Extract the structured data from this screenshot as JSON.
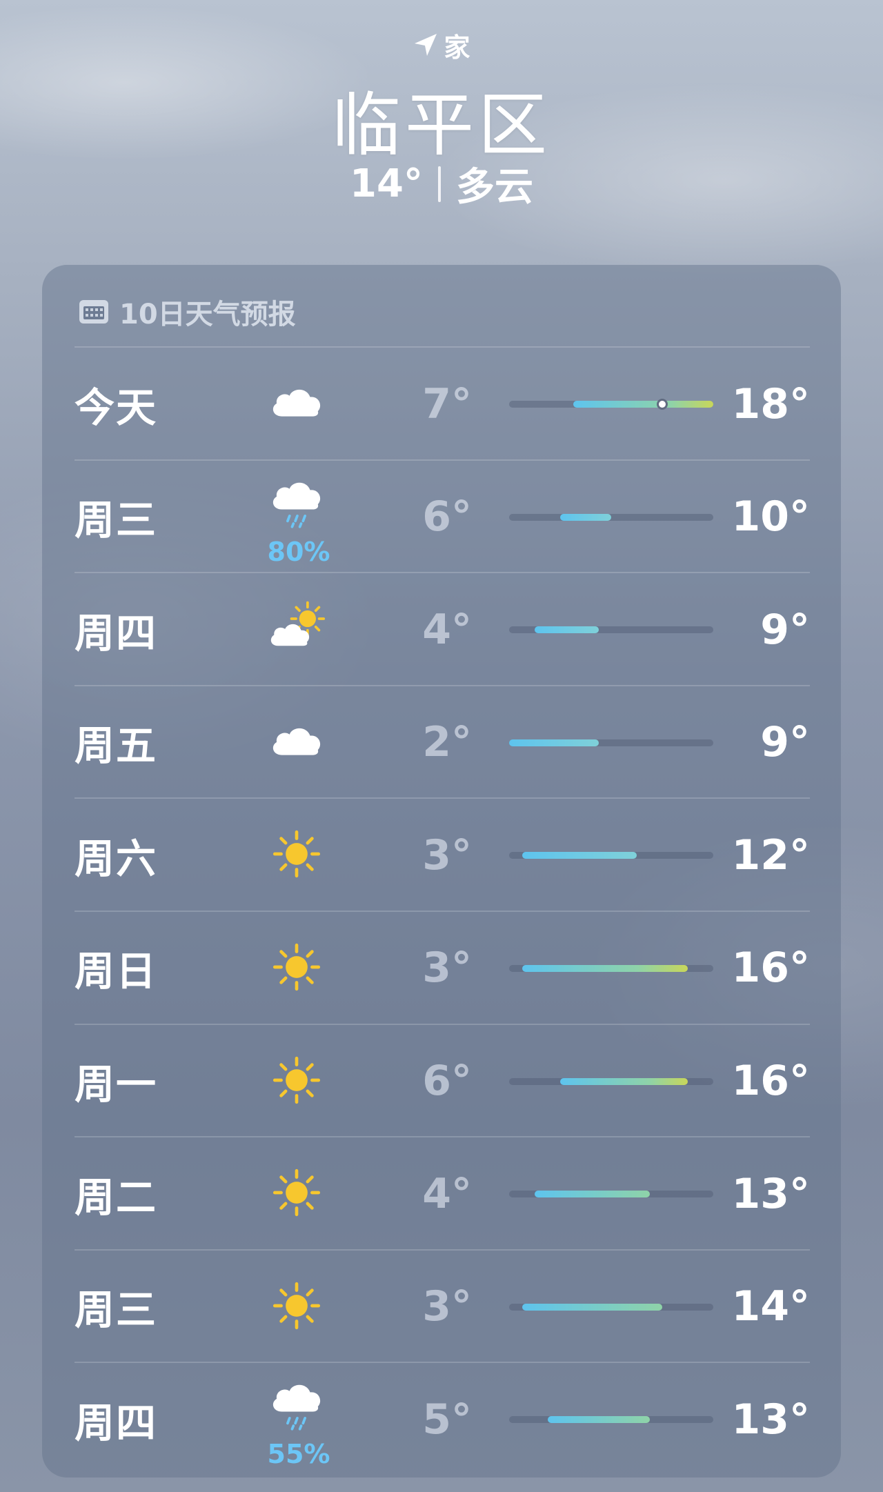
{
  "header": {
    "location_label": "家",
    "city": "临平区",
    "current_temp": "14°",
    "condition": "多云"
  },
  "forecast": {
    "title": "10日天气预报",
    "range_min": 2,
    "range_max": 18,
    "current_temp_value": 14,
    "days": [
      {
        "day": "今天",
        "icon": "cloud-icon",
        "precip": "",
        "low": "7°",
        "high": "18°",
        "low_val": 7,
        "high_val": 18,
        "current": true
      },
      {
        "day": "周三",
        "icon": "cloud-rain-icon",
        "precip": "80%",
        "low": "6°",
        "high": "10°",
        "low_val": 6,
        "high_val": 10
      },
      {
        "day": "周四",
        "icon": "partly-cloudy-icon",
        "precip": "",
        "low": "4°",
        "high": "9°",
        "low_val": 4,
        "high_val": 9
      },
      {
        "day": "周五",
        "icon": "cloud-icon",
        "precip": "",
        "low": "2°",
        "high": "9°",
        "low_val": 2,
        "high_val": 9
      },
      {
        "day": "周六",
        "icon": "sun-icon",
        "precip": "",
        "low": "3°",
        "high": "12°",
        "low_val": 3,
        "high_val": 12
      },
      {
        "day": "周日",
        "icon": "sun-icon",
        "precip": "",
        "low": "3°",
        "high": "16°",
        "low_val": 3,
        "high_val": 16
      },
      {
        "day": "周一",
        "icon": "sun-icon",
        "precip": "",
        "low": "6°",
        "high": "16°",
        "low_val": 6,
        "high_val": 16
      },
      {
        "day": "周二",
        "icon": "sun-icon",
        "precip": "",
        "low": "4°",
        "high": "13°",
        "low_val": 4,
        "high_val": 13
      },
      {
        "day": "周三",
        "icon": "sun-icon",
        "precip": "",
        "low": "3°",
        "high": "14°",
        "low_val": 3,
        "high_val": 14
      },
      {
        "day": "周四",
        "icon": "cloud-rain-icon",
        "precip": "55%",
        "low": "5°",
        "high": "13°",
        "low_val": 5,
        "high_val": 13
      }
    ]
  },
  "colors": {
    "cool": "#5ec4ee",
    "mild": "#8fd3a8",
    "warm": "#c8d65a",
    "sun": "#f7c72e",
    "precip": "#6cc6f6"
  }
}
